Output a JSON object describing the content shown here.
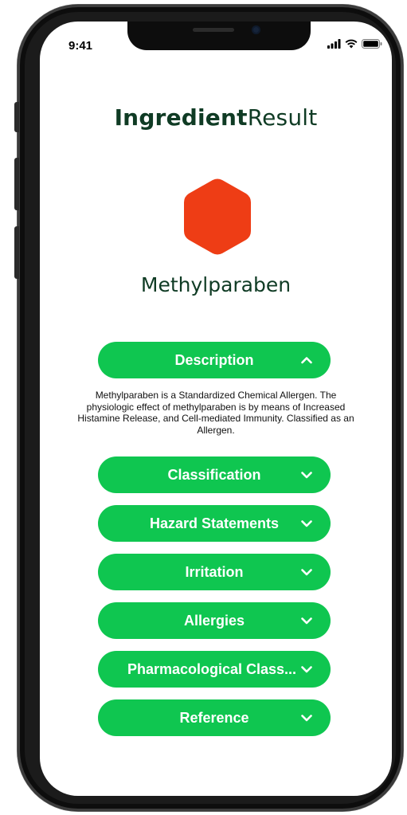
{
  "status_bar": {
    "time": "9:41"
  },
  "header": {
    "title_bold": "Ingredient",
    "title_regular": "Result"
  },
  "ingredient": {
    "name": "Methylparaben",
    "icon": "hexagon-icon",
    "icon_color": "#ee3d15"
  },
  "theme": {
    "accent": "#0fc650",
    "title_color": "#0f3b24"
  },
  "sections": [
    {
      "label": "Description",
      "expanded": true,
      "content": "Methylparaben is a Standardized Chemical Allergen. The physiologic effect of methylparaben is by means of Increased Histamine Release, and Cell-mediated Immunity. Classified as an Allergen."
    },
    {
      "label": "Classification",
      "expanded": false
    },
    {
      "label": "Hazard Statements",
      "expanded": false
    },
    {
      "label": "Irritation",
      "expanded": false
    },
    {
      "label": "Allergies",
      "expanded": false
    },
    {
      "label": "Pharmacological Class...",
      "expanded": false
    },
    {
      "label": "Reference",
      "expanded": false
    }
  ]
}
